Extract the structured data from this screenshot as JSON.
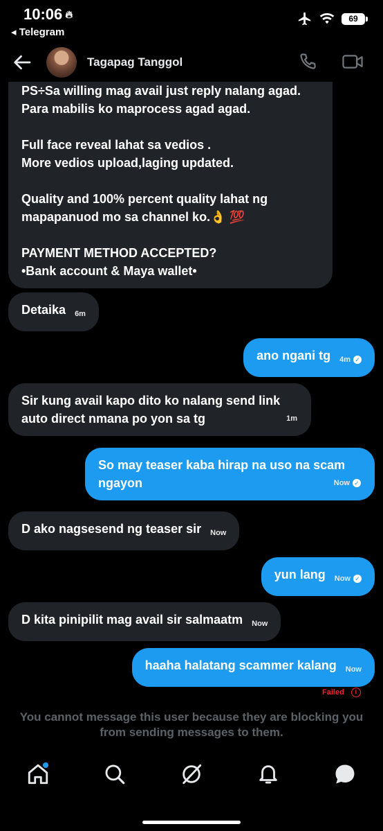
{
  "status_bar": {
    "time": "10:06",
    "back_app": "◂ Telegram",
    "battery": "69"
  },
  "header": {
    "contact_name": "Tagapag Tanggol"
  },
  "messages": [
    {
      "direction": "in",
      "lines": [
        "PS÷Sa willing mag avail just reply nalang agad.",
        "Para mabilis ko maprocess agad agad.",
        "",
        "Full face reveal lahat sa vedios .",
        "More vedios upload,laging updated.",
        "",
        "Quality and 100% percent quality lahat ng",
        "mapapanuod mo sa channel ko.👌 💯",
        "",
        "PAYMENT METHOD ACCEPTED?",
        "•Bank account & Maya wallet•"
      ]
    },
    {
      "direction": "in",
      "text": "Detaika",
      "time": "6m"
    },
    {
      "direction": "out",
      "text": "ano ngani tg",
      "time": "4m"
    },
    {
      "direction": "in",
      "text": "Sir kung avail kapo dito ko nalang send link auto direct nmana po yon sa tg",
      "time": "1m"
    },
    {
      "direction": "out",
      "text": "So may teaser kaba hirap na uso na scam ngayon",
      "time": "Now"
    },
    {
      "direction": "in",
      "text": "D ako nagsesend ng teaser sir",
      "time": "Now"
    },
    {
      "direction": "out",
      "text": "yun lang",
      "time": "Now"
    },
    {
      "direction": "in",
      "text": "D kita pinipilit mag avail sir salmaatm",
      "time": "Now"
    },
    {
      "direction": "out",
      "text": "haaha halatang scammer kalang",
      "time": "Now"
    }
  ],
  "failed_label": "Failed",
  "blocked_notice": "You cannot message this user because they are blocking you from sending messages to them.",
  "bottom_nav": {
    "items": [
      "home-icon",
      "search-icon",
      "grok-icon",
      "notifications-icon",
      "messages-icon"
    ],
    "active": "messages-icon"
  },
  "colors": {
    "accent": "#1d9bf0",
    "incoming_bubble": "#202327",
    "failed": "#f4212e",
    "muted": "#5b6166"
  }
}
